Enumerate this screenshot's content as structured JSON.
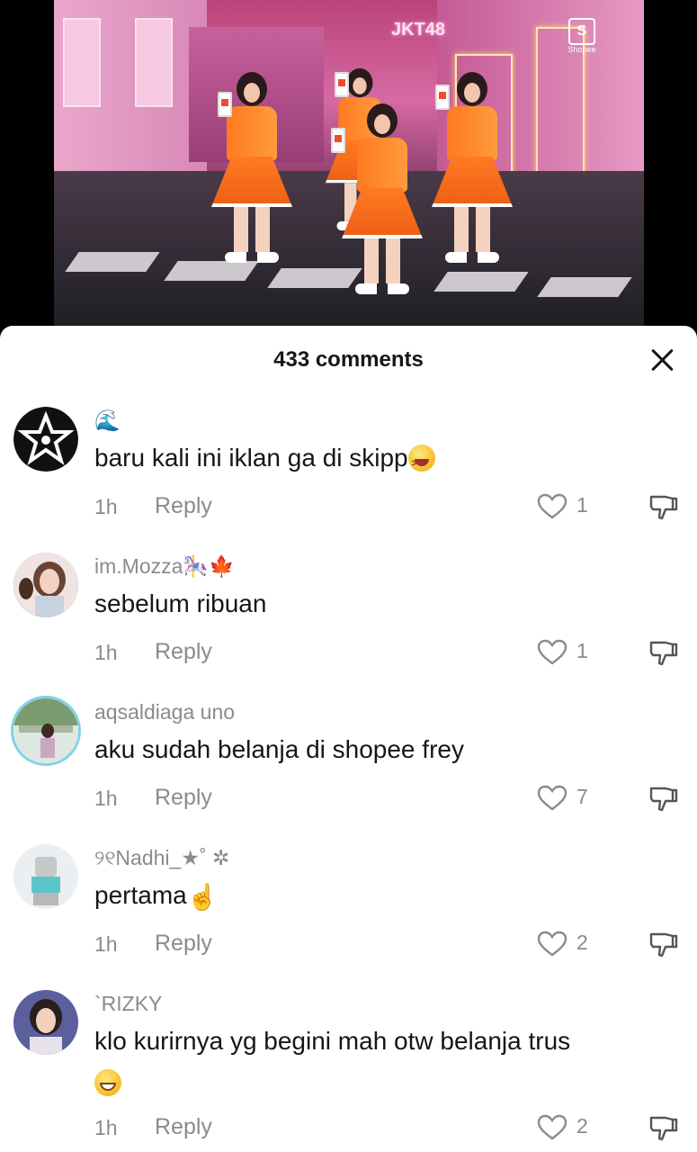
{
  "video": {
    "brand_text": "JKT48",
    "shopee_text": "Shopee",
    "shopee_glyph": "S"
  },
  "sheet": {
    "title": "433 comments",
    "close_icon": "close-icon"
  },
  "comments": [
    {
      "username": "🌊",
      "text": "baru kali ini iklan ga di skipp",
      "emoji": "laughing-face",
      "time": "1h",
      "reply_label": "Reply",
      "likes": "1",
      "avatar": "star-logo-avatar"
    },
    {
      "username": "im.Mozza🎠🍁",
      "text": "sebelum ribuan",
      "time": "1h",
      "reply_label": "Reply",
      "likes": "1",
      "avatar": "girl-photo-avatar"
    },
    {
      "username": "aqsaldiaga uno",
      "text": "aku sudah belanja di shopee frey",
      "time": "1h",
      "reply_label": "Reply",
      "likes": "7",
      "avatar": "outdoor-photo-avatar"
    },
    {
      "username": "୨୧Nadhi_★˚ ✲",
      "text": "pertama",
      "emoji": "pointing-up-hand",
      "time": "1h",
      "reply_label": "Reply",
      "likes": "2",
      "avatar": "figure-avatar"
    },
    {
      "username": "`RIZKY",
      "text": "klo kurirnya yg begini mah otw belanja trus",
      "emoji": "grinning-face",
      "time": "1h",
      "reply_label": "Reply",
      "likes": "2",
      "avatar": "portrait-avatar"
    }
  ],
  "colors": {
    "text_primary": "#161616",
    "text_secondary": "#8a8b91",
    "sheet_bg": "#ffffff",
    "uniform_orange": "#ff7a22"
  }
}
